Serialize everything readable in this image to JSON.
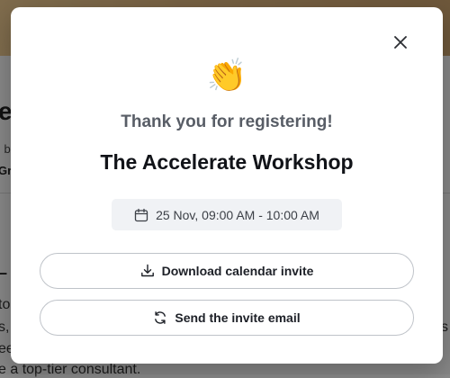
{
  "background": {
    "title_fragment": "el",
    "line1_fragment": "l b",
    "line2_fragment": "Gra",
    "dash_fragment": "–",
    "body": [
      "to",
      "s,",
      "ee",
      "e a top-tier consultant."
    ],
    "right_fragment": "s"
  },
  "modal": {
    "emoji": "👏",
    "subtitle": "Thank you for registering!",
    "title": "The Accelerate Workshop",
    "date_time": "25 Nov, 09:00 AM - 10:00 AM",
    "download_label": "Download calendar invite",
    "email_label": "Send the invite email",
    "icons": {
      "close": "close-icon",
      "calendar": "calendar-icon",
      "download": "download-icon",
      "refresh": "refresh-icon"
    }
  }
}
